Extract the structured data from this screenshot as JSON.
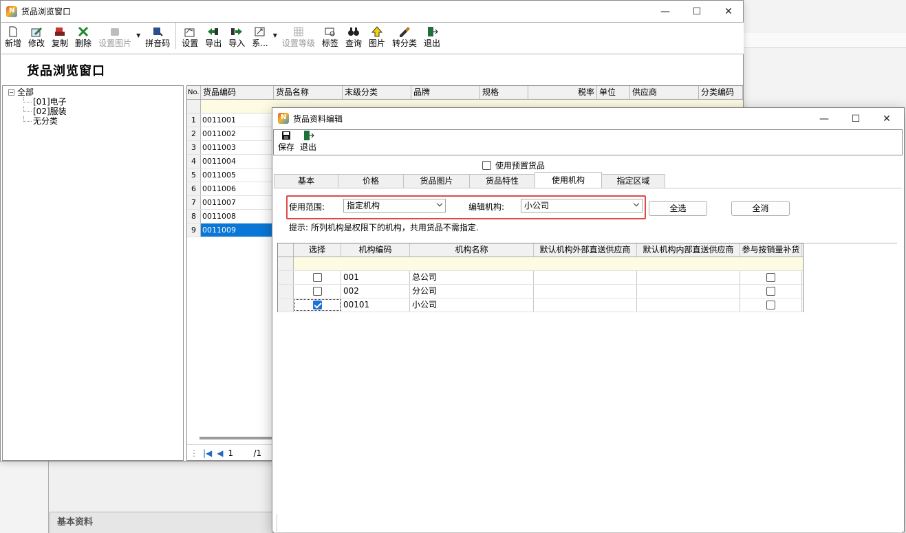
{
  "browse_window": {
    "title": "货品浏览窗口",
    "page_title": "货品浏览窗口",
    "controls": {
      "minimize": "—",
      "maximize": "☐",
      "close": "✕"
    },
    "toolbar": [
      {
        "label": "新增",
        "icon": "new-doc-icon",
        "enabled": true
      },
      {
        "label": "修改",
        "icon": "edit-icon",
        "enabled": true
      },
      {
        "label": "复制",
        "icon": "copy-icon",
        "enabled": true
      },
      {
        "label": "删除",
        "icon": "delete-icon",
        "enabled": true
      },
      {
        "label": "设置图片",
        "icon": "image-settings-icon",
        "enabled": false
      },
      {
        "label": "拼音码",
        "icon": "pinyin-icon",
        "enabled": true
      },
      {
        "label": "设置",
        "icon": "settings-icon",
        "enabled": true
      },
      {
        "label": "导出",
        "icon": "export-icon",
        "enabled": true
      },
      {
        "label": "导入",
        "icon": "import-icon",
        "enabled": true
      },
      {
        "label": "系...",
        "icon": "system-icon",
        "enabled": true
      },
      {
        "label": "设置等级",
        "icon": "grade-icon",
        "enabled": false
      },
      {
        "label": "标签",
        "icon": "label-icon",
        "enabled": true
      },
      {
        "label": "查询",
        "icon": "binoculars-icon",
        "enabled": true
      },
      {
        "label": "图片",
        "icon": "picture-icon",
        "enabled": true
      },
      {
        "label": "转分类",
        "icon": "brush-icon",
        "enabled": true
      },
      {
        "label": "退出",
        "icon": "exit-icon",
        "enabled": true
      }
    ],
    "tree": {
      "root": "全部",
      "toggle": "⊟",
      "children": [
        "[01]电子",
        "[02]服装",
        "无分类"
      ]
    },
    "grid": {
      "columns": [
        "No.",
        "货品编码",
        "货品名称",
        "末级分类",
        "品牌",
        "规格",
        "税率",
        "单位",
        "供应商",
        "分类编码"
      ],
      "rows": [
        {
          "no": "1",
          "code": "0011001"
        },
        {
          "no": "2",
          "code": "0011002"
        },
        {
          "no": "3",
          "code": "0011003"
        },
        {
          "no": "4",
          "code": "0011004"
        },
        {
          "no": "5",
          "code": "0011005"
        },
        {
          "no": "6",
          "code": "0011006"
        },
        {
          "no": "7",
          "code": "0011007"
        },
        {
          "no": "8",
          "code": "0011008"
        },
        {
          "no": "9",
          "code": "0011009"
        }
      ],
      "selected_row": 9
    },
    "pager": {
      "first": "|◀",
      "prev": "◀",
      "page": "1",
      "total": "/1"
    }
  },
  "edit_dialog": {
    "title": "货品资料编辑",
    "controls": {
      "minimize": "—",
      "maximize": "☐",
      "close": "✕"
    },
    "toolbar": [
      {
        "label": "保存",
        "icon": "save-icon"
      },
      {
        "label": "退出",
        "icon": "exit-icon"
      }
    ],
    "preset_checkbox": {
      "label": "使用预置货品",
      "checked": false
    },
    "tabs": [
      "基本",
      "价格",
      "货品图片",
      "货品特性",
      "使用机构",
      "指定区域"
    ],
    "active_tab": "使用机构",
    "scope_label": "使用范围:",
    "scope_value": "指定机构",
    "edit_org_label": "编辑机构:",
    "edit_org_value": "小公司",
    "select_all": "全选",
    "clear_all": "全消",
    "hint": "提示: 所列机构是权限下的机构，共用货品不需指定.",
    "org_grid": {
      "columns": [
        "选择",
        "机构编码",
        "机构名称",
        "默认机构外部直送供应商",
        "默认机构内部直送供应商",
        "参与按销量补货"
      ],
      "rows": [
        {
          "selected": false,
          "code": "001",
          "name": "总公司",
          "replenish": false
        },
        {
          "selected": false,
          "code": "002",
          "name": "分公司",
          "replenish": false
        },
        {
          "selected": true,
          "code": "00101",
          "name": "小公司",
          "replenish": false
        }
      ]
    }
  },
  "background": {
    "tab_label": "基本资料"
  },
  "colors": {
    "selection": "#0a76d6",
    "highlight_border": "#e04848",
    "filter_row": "#fdfbe2"
  }
}
